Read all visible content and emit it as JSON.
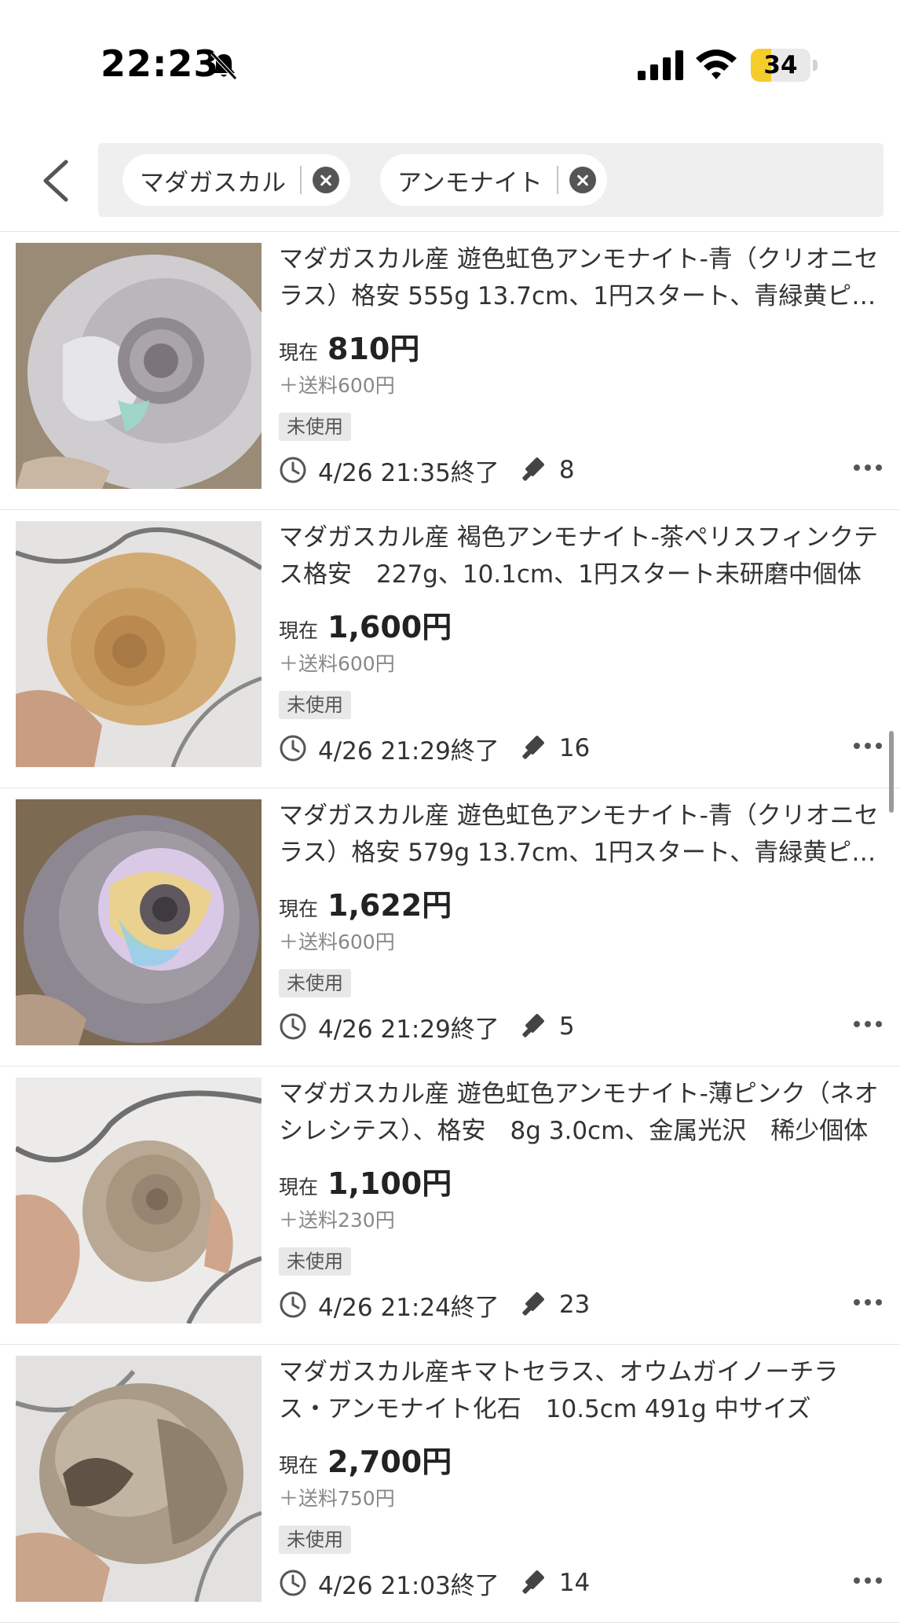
{
  "status_bar": {
    "time": "22:23",
    "battery": "34",
    "battery_level": 0.34
  },
  "search": {
    "chips": [
      {
        "label": "マダガスカル",
        "clear_icon": "x-circle-icon"
      },
      {
        "label": "アンモナイト",
        "clear_icon": "x-circle-icon"
      }
    ]
  },
  "items": [
    {
      "title": "マダガスカル産 遊色虹色アンモナイト-青（クリオニセラス）格安 555g 13.7cm、1円スタート、青緑黄ピ…",
      "price_label": "現在",
      "price": "810円",
      "shipping": "＋送料600円",
      "condition": "未使用",
      "end_time": "4/26 21:35終了",
      "bids": "8"
    },
    {
      "title": "マダガスカル産 褐色アンモナイト-茶ペリスフィンクテス格安　227g、10.1cm、1円スタート未研磨中個体",
      "price_label": "現在",
      "price": "1,600円",
      "shipping": "＋送料600円",
      "condition": "未使用",
      "end_time": "4/26 21:29終了",
      "bids": "16"
    },
    {
      "title": "マダガスカル産 遊色虹色アンモナイト-青（クリオニセラス）格安 579g 13.7cm、1円スタート、青緑黄ピ…",
      "price_label": "現在",
      "price": "1,622円",
      "shipping": "＋送料600円",
      "condition": "未使用",
      "end_time": "4/26 21:29終了",
      "bids": "5"
    },
    {
      "title": "マダガスカル産 遊色虹色アンモナイト-薄ピンク（ネオシレシテス）、格安　8g 3.0cm、金属光沢　稀少個体",
      "price_label": "現在",
      "price": "1,100円",
      "shipping": "＋送料230円",
      "condition": "未使用",
      "end_time": "4/26 21:24終了",
      "bids": "23"
    },
    {
      "title": "マダガスカル産キマトセラス、オウムガイノーチラス・アンモナイト化石　10.5cm 491g 中サイズ",
      "price_label": "現在",
      "price": "2,700円",
      "shipping": "＋送料750円",
      "condition": "未使用",
      "end_time": "4/26 21:03終了",
      "bids": "14"
    }
  ],
  "icons": {
    "back": "chevron-left-icon",
    "time": "clock-icon",
    "bids": "gavel-icon",
    "more": "more-icon"
  },
  "colors": {
    "battery_fill": "#f5cd2b",
    "search_bg": "#efefef"
  }
}
